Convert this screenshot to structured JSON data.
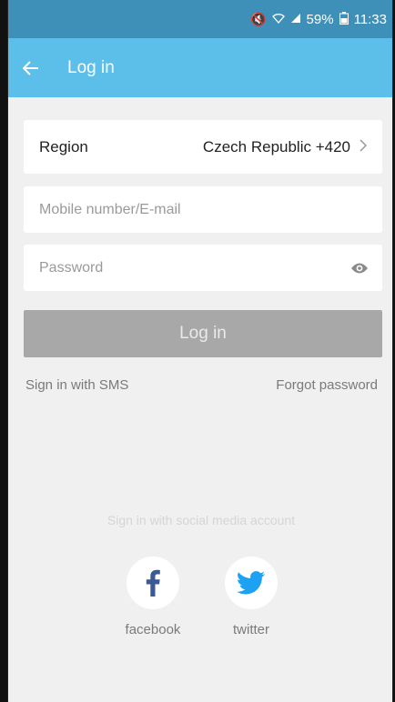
{
  "status": {
    "battery": "59%",
    "time": "11:33"
  },
  "appbar": {
    "title": "Log in"
  },
  "form": {
    "region_label": "Region",
    "region_value": "Czech Republic +420",
    "mobile_placeholder": "Mobile number/E-mail",
    "password_placeholder": "Password",
    "login_label": "Log in",
    "sms_link": "Sign in with SMS",
    "forgot_link": "Forgot password"
  },
  "social": {
    "title": "Sign in with social media account",
    "facebook_label": "facebook",
    "twitter_label": "twitter"
  },
  "colors": {
    "statusbar": "#3f90b8",
    "appbar": "#5bbfea",
    "facebook": "#3b5998",
    "twitter": "#1da1f2",
    "button_disabled": "#a8a8a8"
  }
}
